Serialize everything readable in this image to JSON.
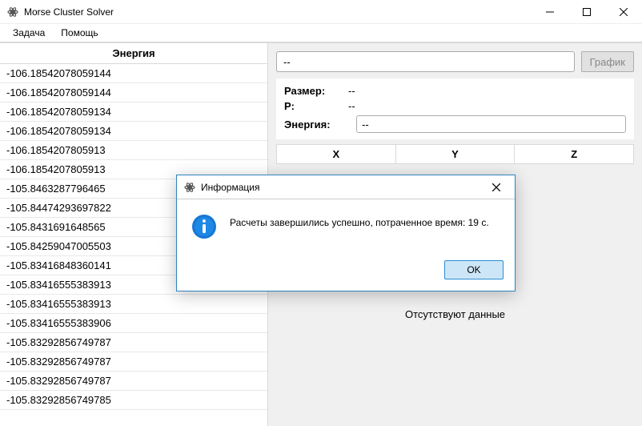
{
  "window": {
    "title": "Morse Cluster Solver"
  },
  "menu": {
    "task": "Задача",
    "help": "Помощь"
  },
  "left": {
    "header": "Энергия",
    "rows": [
      "-106.18542078059144",
      "-106.18542078059144",
      "-106.18542078059134",
      "-106.18542078059134",
      "-106.1854207805913",
      "-106.1854207805913",
      "-105.8463287796465",
      "-105.84474293697822",
      "-105.8431691648565",
      "-105.84259047005503",
      "-105.83416848360141",
      "-105.83416555383913",
      "-105.83416555383913",
      "-105.83416555383906",
      "-105.83292856749787",
      "-105.83292856749787",
      "-105.83292856749787",
      "-105.83292856749785"
    ]
  },
  "right": {
    "top_value": "--",
    "graph_btn": "График",
    "size_label": "Размер:",
    "size_val": "--",
    "p_label": "P:",
    "p_val": "--",
    "energy_label": "Энергия:",
    "energy_val": "--",
    "col_x": "X",
    "col_y": "Y",
    "col_z": "Z",
    "no_data": "Отсутствуют данные"
  },
  "dialog": {
    "title": "Информация",
    "message": "Расчеты завершились успешно, потраченное время: 19 с.",
    "ok": "OK"
  }
}
